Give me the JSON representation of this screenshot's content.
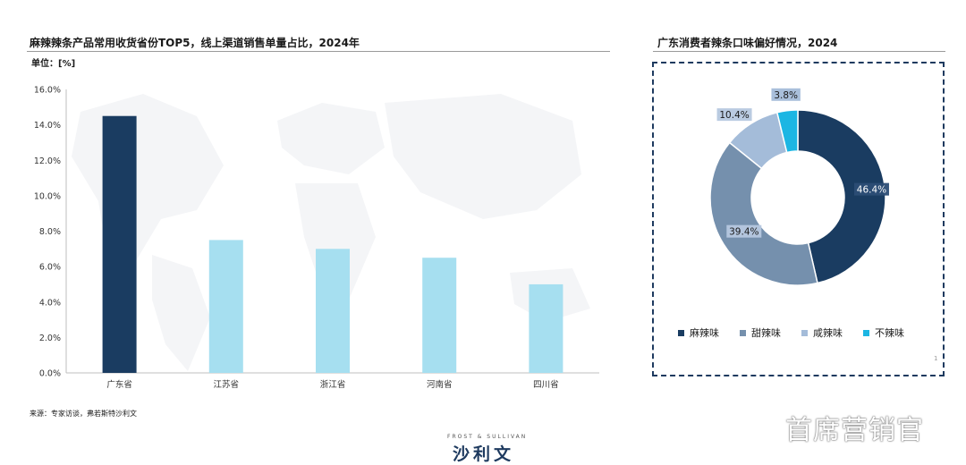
{
  "left": {
    "title": "麻辣辣条产品常用收货省份TOP5，线上渠道销售单量占比，2024年",
    "unit_label": "单位：[%]",
    "source": "来源：专家访谈，弗若斯特沙利文"
  },
  "right": {
    "title": "广东消费者辣条口味偏好情况，2024",
    "page_number": "1"
  },
  "brand": {
    "small": "FROST & SULLIVAN",
    "big": "沙利文"
  },
  "watermark": "首席营销官",
  "colors": {
    "dark_navy": "#1a3c61",
    "light_blue": "#a6dff0",
    "slate": "#7590ad",
    "pale_blue": "#a4bcd9",
    "cyan": "#1cb6e3",
    "frame": "#1e3a5f"
  },
  "chart_data": [
    {
      "type": "bar",
      "categories": [
        "广东省",
        "江苏省",
        "浙江省",
        "河南省",
        "四川省"
      ],
      "values": [
        14.5,
        7.5,
        7.0,
        6.5,
        5.0
      ],
      "bar_colors": [
        "#1a3c61",
        "#a6dff0",
        "#a6dff0",
        "#a6dff0",
        "#a6dff0"
      ],
      "ylim": [
        0,
        16
      ],
      "yticks": [
        "0.0%",
        "2.0%",
        "4.0%",
        "6.0%",
        "8.0%",
        "10.0%",
        "12.0%",
        "14.0%",
        "16.0%"
      ],
      "unit": "%",
      "grid": false
    },
    {
      "type": "pie",
      "donut": true,
      "slices": [
        {
          "label": "麻辣味",
          "value": 46.4,
          "display": "46.4%",
          "color": "#1a3c61"
        },
        {
          "label": "甜辣味",
          "value": 39.4,
          "display": "39.4%",
          "color": "#7590ad"
        },
        {
          "label": "咸辣味",
          "value": 10.4,
          "display": "10.4%",
          "color": "#a4bcd9"
        },
        {
          "label": "不辣味",
          "value": 3.8,
          "display": "3.8%",
          "color": "#1cb6e3"
        }
      ],
      "legend_position": "bottom"
    }
  ]
}
